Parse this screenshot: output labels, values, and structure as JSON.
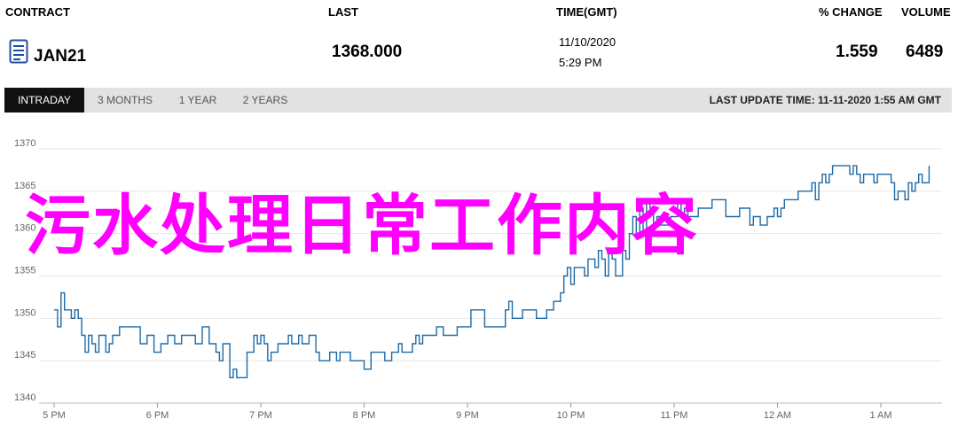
{
  "header": {
    "contract_label": "CONTRACT",
    "last_label": "LAST",
    "time_label": "TIME(GMT)",
    "change_label": "% CHANGE",
    "volume_label": "VOLUME"
  },
  "quote": {
    "contract": "JAN21",
    "contract_icon": "document-icon",
    "last": "1368.000",
    "date": "11/10/2020",
    "time": "5:29 PM",
    "change": "1.559",
    "volume": "6489"
  },
  "tabs": [
    {
      "label": "INTRADAY",
      "active": true
    },
    {
      "label": "3 MONTHS",
      "active": false
    },
    {
      "label": "1 YEAR",
      "active": false
    },
    {
      "label": "2 YEARS",
      "active": false
    }
  ],
  "last_update": "LAST UPDATE TIME: 11-11-2020 1:55 AM GMT",
  "overlay_text": "污水处理日常工作内容",
  "colors": {
    "line": "#1f6aa5",
    "overlay": "#ff00ff",
    "tab_active": "#111111",
    "tab_bar": "#e2e2e2"
  },
  "chart_data": {
    "type": "line",
    "title": "",
    "xlabel": "",
    "ylabel": "",
    "ylim": [
      1340,
      1370
    ],
    "yticks": [
      1340,
      1345,
      1350,
      1355,
      1360,
      1365,
      1370
    ],
    "xlim": [
      0,
      540
    ],
    "xticks": [
      {
        "t": 0,
        "label": "5 PM"
      },
      {
        "t": 60,
        "label": "6 PM"
      },
      {
        "t": 120,
        "label": "7 PM"
      },
      {
        "t": 180,
        "label": "8 PM"
      },
      {
        "t": 240,
        "label": "9 PM"
      },
      {
        "t": 300,
        "label": "10 PM"
      },
      {
        "t": 360,
        "label": "11 PM"
      },
      {
        "t": 420,
        "label": "12 AM"
      },
      {
        "t": 480,
        "label": "1 AM"
      }
    ],
    "grid": true,
    "series": [
      {
        "values": [
          [
            0,
            1351
          ],
          [
            2,
            1349
          ],
          [
            4,
            1353
          ],
          [
            6,
            1351
          ],
          [
            8,
            1351
          ],
          [
            10,
            1350
          ],
          [
            12,
            1351
          ],
          [
            14,
            1350
          ],
          [
            16,
            1348
          ],
          [
            18,
            1346
          ],
          [
            20,
            1348
          ],
          [
            22,
            1347
          ],
          [
            24,
            1346
          ],
          [
            26,
            1348
          ],
          [
            28,
            1348
          ],
          [
            30,
            1346
          ],
          [
            32,
            1347
          ],
          [
            34,
            1348
          ],
          [
            38,
            1349
          ],
          [
            42,
            1349
          ],
          [
            46,
            1349
          ],
          [
            50,
            1347
          ],
          [
            54,
            1348
          ],
          [
            58,
            1346
          ],
          [
            62,
            1347
          ],
          [
            66,
            1348
          ],
          [
            70,
            1347
          ],
          [
            74,
            1348
          ],
          [
            78,
            1348
          ],
          [
            82,
            1347
          ],
          [
            86,
            1349
          ],
          [
            90,
            1347
          ],
          [
            94,
            1346
          ],
          [
            96,
            1345
          ],
          [
            98,
            1347
          ],
          [
            100,
            1347
          ],
          [
            102,
            1343
          ],
          [
            104,
            1344
          ],
          [
            106,
            1343
          ],
          [
            110,
            1343
          ],
          [
            112,
            1346
          ],
          [
            114,
            1346
          ],
          [
            116,
            1348
          ],
          [
            118,
            1347
          ],
          [
            120,
            1348
          ],
          [
            122,
            1347
          ],
          [
            124,
            1345
          ],
          [
            126,
            1346
          ],
          [
            128,
            1346
          ],
          [
            130,
            1347
          ],
          [
            134,
            1347
          ],
          [
            136,
            1348
          ],
          [
            138,
            1347
          ],
          [
            142,
            1348
          ],
          [
            144,
            1347
          ],
          [
            148,
            1348
          ],
          [
            152,
            1346
          ],
          [
            154,
            1345
          ],
          [
            158,
            1345
          ],
          [
            160,
            1346
          ],
          [
            164,
            1345
          ],
          [
            166,
            1346
          ],
          [
            170,
            1346
          ],
          [
            172,
            1345
          ],
          [
            176,
            1345
          ],
          [
            180,
            1344
          ],
          [
            184,
            1346
          ],
          [
            188,
            1346
          ],
          [
            192,
            1345
          ],
          [
            196,
            1346
          ],
          [
            200,
            1347
          ],
          [
            202,
            1346
          ],
          [
            206,
            1346
          ],
          [
            208,
            1347
          ],
          [
            210,
            1348
          ],
          [
            212,
            1347
          ],
          [
            214,
            1348
          ],
          [
            218,
            1348
          ],
          [
            222,
            1349
          ],
          [
            226,
            1348
          ],
          [
            230,
            1348
          ],
          [
            234,
            1349
          ],
          [
            238,
            1349
          ],
          [
            242,
            1351
          ],
          [
            246,
            1351
          ],
          [
            250,
            1349
          ],
          [
            254,
            1349
          ],
          [
            258,
            1349
          ],
          [
            262,
            1351
          ],
          [
            264,
            1352
          ],
          [
            266,
            1350
          ],
          [
            270,
            1350
          ],
          [
            272,
            1351
          ],
          [
            276,
            1351
          ],
          [
            280,
            1350
          ],
          [
            284,
            1350
          ],
          [
            286,
            1351
          ],
          [
            290,
            1352
          ],
          [
            294,
            1353
          ],
          [
            296,
            1355
          ],
          [
            298,
            1356
          ],
          [
            300,
            1354
          ],
          [
            302,
            1356
          ],
          [
            306,
            1356
          ],
          [
            308,
            1355
          ],
          [
            310,
            1357
          ],
          [
            314,
            1356
          ],
          [
            316,
            1358
          ],
          [
            318,
            1357
          ],
          [
            320,
            1355
          ],
          [
            322,
            1358
          ],
          [
            324,
            1357
          ],
          [
            326,
            1355
          ],
          [
            328,
            1355
          ],
          [
            330,
            1358
          ],
          [
            332,
            1357
          ],
          [
            334,
            1360
          ],
          [
            336,
            1362
          ],
          [
            338,
            1360
          ],
          [
            340,
            1363
          ],
          [
            342,
            1360
          ],
          [
            344,
            1364
          ],
          [
            346,
            1363
          ],
          [
            348,
            1361
          ],
          [
            350,
            1362
          ],
          [
            352,
            1361
          ],
          [
            356,
            1361
          ],
          [
            358,
            1362
          ],
          [
            360,
            1362
          ],
          [
            362,
            1364
          ],
          [
            364,
            1362
          ],
          [
            366,
            1363
          ],
          [
            368,
            1362
          ],
          [
            370,
            1362
          ],
          [
            374,
            1363
          ],
          [
            378,
            1363
          ],
          [
            382,
            1364
          ],
          [
            386,
            1364
          ],
          [
            390,
            1362
          ],
          [
            394,
            1362
          ],
          [
            398,
            1363
          ],
          [
            400,
            1363
          ],
          [
            404,
            1361
          ],
          [
            406,
            1362
          ],
          [
            408,
            1362
          ],
          [
            410,
            1361
          ],
          [
            414,
            1362
          ],
          [
            418,
            1363
          ],
          [
            420,
            1362
          ],
          [
            422,
            1363
          ],
          [
            424,
            1364
          ],
          [
            428,
            1364
          ],
          [
            432,
            1365
          ],
          [
            436,
            1365
          ],
          [
            440,
            1366
          ],
          [
            442,
            1364
          ],
          [
            444,
            1366
          ],
          [
            446,
            1367
          ],
          [
            448,
            1366
          ],
          [
            450,
            1367
          ],
          [
            452,
            1368
          ],
          [
            456,
            1368
          ],
          [
            460,
            1368
          ],
          [
            462,
            1367
          ],
          [
            464,
            1368
          ],
          [
            466,
            1367
          ],
          [
            468,
            1366
          ],
          [
            470,
            1367
          ],
          [
            472,
            1367
          ],
          [
            476,
            1366
          ],
          [
            478,
            1367
          ],
          [
            482,
            1367
          ],
          [
            486,
            1366
          ],
          [
            488,
            1364
          ],
          [
            490,
            1365
          ],
          [
            492,
            1365
          ],
          [
            494,
            1364
          ],
          [
            496,
            1366
          ],
          [
            498,
            1365
          ],
          [
            500,
            1366
          ],
          [
            502,
            1367
          ],
          [
            504,
            1366
          ],
          [
            506,
            1366
          ],
          [
            508,
            1368
          ]
        ]
      }
    ]
  }
}
